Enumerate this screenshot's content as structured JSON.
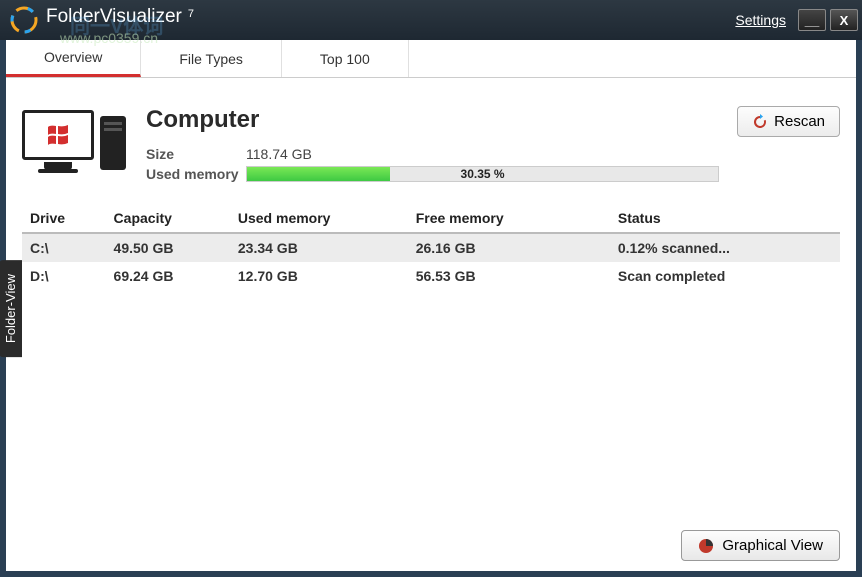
{
  "app": {
    "name": "FolderVisualizer",
    "version": "7"
  },
  "watermark": "www.pc0359.cn",
  "watermark2": "同一V体词",
  "titlebar": {
    "settings": "Settings"
  },
  "tabs": {
    "overview": "Overview",
    "filetypes": "File Types",
    "top100": "Top 100"
  },
  "summary": {
    "heading": "Computer",
    "size_label": "Size",
    "size_value": "118.74 GB",
    "used_label": "Used memory",
    "used_percent_text": "30.35 %",
    "used_percent": 30.35
  },
  "buttons": {
    "rescan": "Rescan",
    "graphical": "Graphical View"
  },
  "sidetab": "Folder-View",
  "table": {
    "headers": {
      "drive": "Drive",
      "capacity": "Capacity",
      "used": "Used memory",
      "free": "Free memory",
      "status": "Status"
    },
    "rows": [
      {
        "drive": "C:\\",
        "capacity": "49.50 GB",
        "used": "23.34 GB",
        "free": "26.16 GB",
        "status": "0.12% scanned..."
      },
      {
        "drive": "D:\\",
        "capacity": "69.24 GB",
        "used": "12.70 GB",
        "free": "56.53 GB",
        "status": "Scan completed"
      }
    ]
  }
}
